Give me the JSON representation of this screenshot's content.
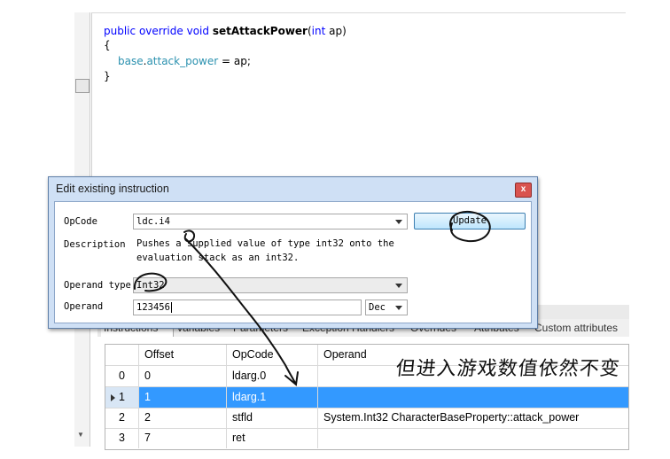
{
  "code": {
    "line1": {
      "kw1": "public",
      "kw2": "override",
      "kw3": "void",
      "method": "setAttackPower",
      "open_paren": "(",
      "param_type": "int",
      "param_name": " ap)"
    },
    "line2": "{",
    "line3": {
      "base": "base",
      "dot": ".",
      "field": "attack_power",
      "rest": " = ap;"
    },
    "line4": "}"
  },
  "dialog": {
    "title": "Edit existing instruction",
    "close_glyph": "x",
    "opcode_label": "OpCode",
    "opcode_value": "ldc.i4",
    "update_button": "Update",
    "description_label": "Description",
    "description_text": "Pushes a supplied value of type int32 onto the evaluation stack as an int32.",
    "operand_type_label": "Operand type",
    "operand_type_value": "Int32",
    "operand_label": "Operand",
    "operand_value": "123456",
    "base_value": "Dec"
  },
  "tabs": [
    "Instructions",
    "Variables",
    "Parameters",
    "Exception Handlers",
    "Overrides",
    "Attributes",
    "Custom attributes"
  ],
  "grid": {
    "headers": [
      "",
      "Offset",
      "OpCode",
      "Operand"
    ],
    "rows": [
      {
        "index": "0",
        "offset": "0",
        "opcode": "ldarg.0",
        "operand": ""
      },
      {
        "index": "1",
        "offset": "1",
        "opcode": "ldarg.1",
        "operand": ""
      },
      {
        "index": "2",
        "offset": "2",
        "opcode": "stfld",
        "operand": "System.Int32 CharacterBaseProperty::attack_power"
      },
      {
        "index": "3",
        "offset": "7",
        "opcode": "ret",
        "operand": ""
      }
    ],
    "selected_row": 1
  },
  "annotation": "但进入游戏数值依然不变",
  "colors": {
    "keyword": "#0000ff",
    "selection": "#3399ff",
    "dialog_frame": "#cfe0f5"
  }
}
